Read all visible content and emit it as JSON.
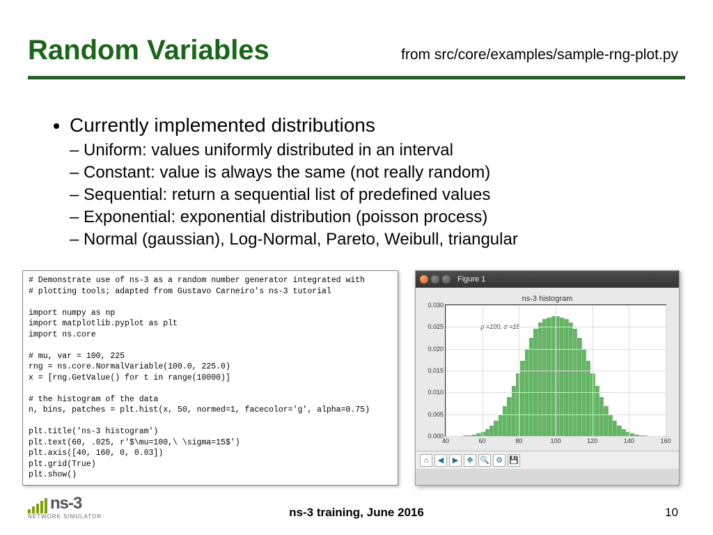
{
  "title": "Random Variables",
  "source_note": "from src/core/examples/sample-rng-plot.py",
  "bullet_main": "Currently implemented distributions",
  "bullet_sub": [
    "Uniform: values uniformly distributed in an interval",
    "Constant: value is always the same (not really random)",
    "Sequential: return a sequential list of predefined values",
    "Exponential: exponential distribution (poisson process)",
    "Normal (gaussian), Log-Normal, Pareto, Weibull, triangular"
  ],
  "code": "# Demonstrate use of ns-3 as a random number generator integrated with\n# plotting tools; adapted from Gustavo Carneiro's ns-3 tutorial\n\nimport numpy as np\nimport matplotlib.pyplot as plt\nimport ns.core\n\n# mu, var = 100, 225\nrng = ns.core.NormalVariable(100.0, 225.0)\nx = [rng.GetValue() for t in range(10000)]\n\n# the histogram of the data\nn, bins, patches = plt.hist(x, 50, normed=1, facecolor='g', alpha=0.75)\n\nplt.title('ns-3 histogram')\nplt.text(60, .025, r'$\\mu=100,\\ \\sigma=15$')\nplt.axis([40, 160, 0, 0.03])\nplt.grid(True)\nplt.show()",
  "figure": {
    "window_title": "Figure 1",
    "chart_title": "ns-3 histogram",
    "annotation": "μ =100, σ =15"
  },
  "chart_data": {
    "type": "bar",
    "title": "ns-3 histogram",
    "xlabel": "",
    "ylabel": "",
    "xlim": [
      40,
      160
    ],
    "ylim": [
      0,
      0.03
    ],
    "y_ticks": [
      0.0,
      0.005,
      0.01,
      0.015,
      0.02,
      0.025,
      0.03
    ],
    "x_ticks": [
      40,
      60,
      80,
      100,
      120,
      140,
      160
    ],
    "annotation": {
      "x": 60,
      "y": 0.025,
      "text": "μ=100, σ=15"
    },
    "categories": [
      41.2,
      43.6,
      46.0,
      48.4,
      50.8,
      53.2,
      55.6,
      58.0,
      60.4,
      62.8,
      65.2,
      67.6,
      70.0,
      72.4,
      74.8,
      77.2,
      79.6,
      82.0,
      84.4,
      86.8,
      89.2,
      91.6,
      94.0,
      96.4,
      98.8,
      101.2,
      103.6,
      106.0,
      108.4,
      110.8,
      113.2,
      115.6,
      118.0,
      120.4,
      122.8,
      125.2,
      127.6,
      130.0,
      132.4,
      134.8,
      137.2,
      139.6,
      142.0,
      144.4,
      146.8,
      149.2,
      151.6,
      154.0,
      156.4,
      158.8
    ],
    "values": [
      0.0,
      0.0,
      0.0,
      0.0,
      0.0001,
      0.0002,
      0.0004,
      0.0006,
      0.001,
      0.0016,
      0.0024,
      0.0035,
      0.005,
      0.0068,
      0.009,
      0.0115,
      0.0143,
      0.0172,
      0.02,
      0.0225,
      0.0245,
      0.026,
      0.0268,
      0.0272,
      0.0275,
      0.0275,
      0.0272,
      0.0268,
      0.026,
      0.0245,
      0.0225,
      0.02,
      0.0172,
      0.0143,
      0.0115,
      0.009,
      0.0068,
      0.005,
      0.0035,
      0.0024,
      0.0016,
      0.001,
      0.0006,
      0.0004,
      0.0002,
      0.0001,
      0.0,
      0.0,
      0.0,
      0.0
    ]
  },
  "footer": {
    "center": "ns-3 training, June 2016",
    "page": "10",
    "logo_text": "ns-3",
    "logo_sub": "NETWORK SIMULATOR"
  }
}
